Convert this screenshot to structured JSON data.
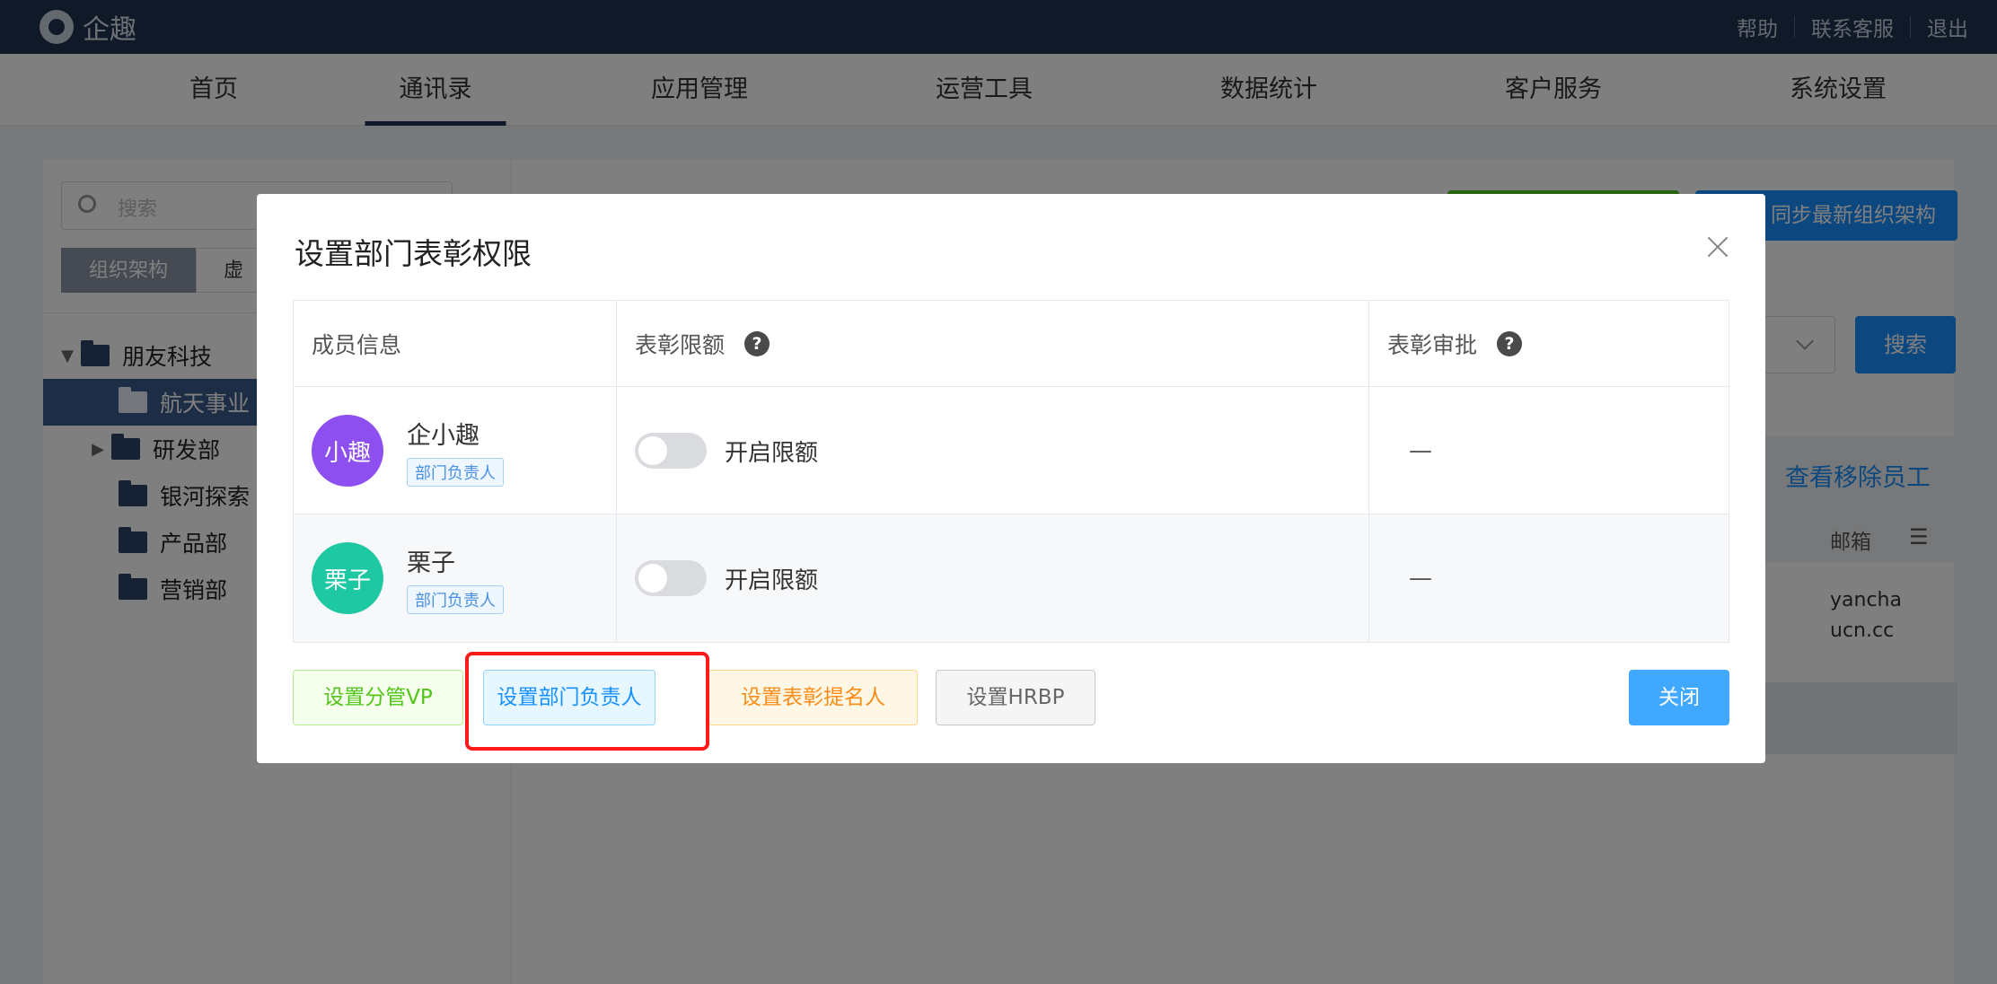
{
  "app": {
    "brand": "企趣"
  },
  "topbar": {
    "links": [
      "帮助",
      "联系客服",
      "退出"
    ]
  },
  "nav": {
    "items": [
      "首页",
      "通讯录",
      "应用管理",
      "运营工具",
      "数据统计",
      "客户服务",
      "系统设置"
    ],
    "active": "通讯录"
  },
  "sidebar": {
    "search_placeholder": "搜索",
    "tabs": [
      "组织架构",
      "虚"
    ],
    "tree": [
      {
        "label": "朋友科技",
        "expanded": true
      },
      {
        "label": "航天事业",
        "selected": true
      },
      {
        "label": "研发部",
        "collapsed": true
      },
      {
        "label": "银河探索"
      },
      {
        "label": "产品部"
      },
      {
        "label": "营销部"
      }
    ]
  },
  "background": {
    "sync_button": "同步最新组织架构",
    "search_button": "搜索",
    "view_removed": "查看移除员工",
    "email_header": "邮箱",
    "email_value_1": "yancha",
    "email_value_2": "ucn.cc"
  },
  "modal": {
    "title": "设置部门表彰权限",
    "columns": [
      "成员信息",
      "表彰限额",
      "表彰审批"
    ],
    "rows": [
      {
        "avatar_text": "小趣",
        "avatar_color": "#8e4ff0",
        "name": "企小趣",
        "role": "部门负责人",
        "toggle_label": "开启限额",
        "toggle_on": false,
        "approval": "—"
      },
      {
        "avatar_text": "栗子",
        "avatar_color": "#1ec8a3",
        "name": "栗子",
        "role": "部门负责人",
        "toggle_label": "开启限额",
        "toggle_on": false,
        "approval": "—"
      }
    ],
    "buttons": {
      "vp": "设置分管VP",
      "dept_head": "设置部门负责人",
      "nominator": "设置表彰提名人",
      "hrbp": "设置HRBP",
      "close": "关闭"
    },
    "highlighted_button": "设置部门负责人"
  }
}
